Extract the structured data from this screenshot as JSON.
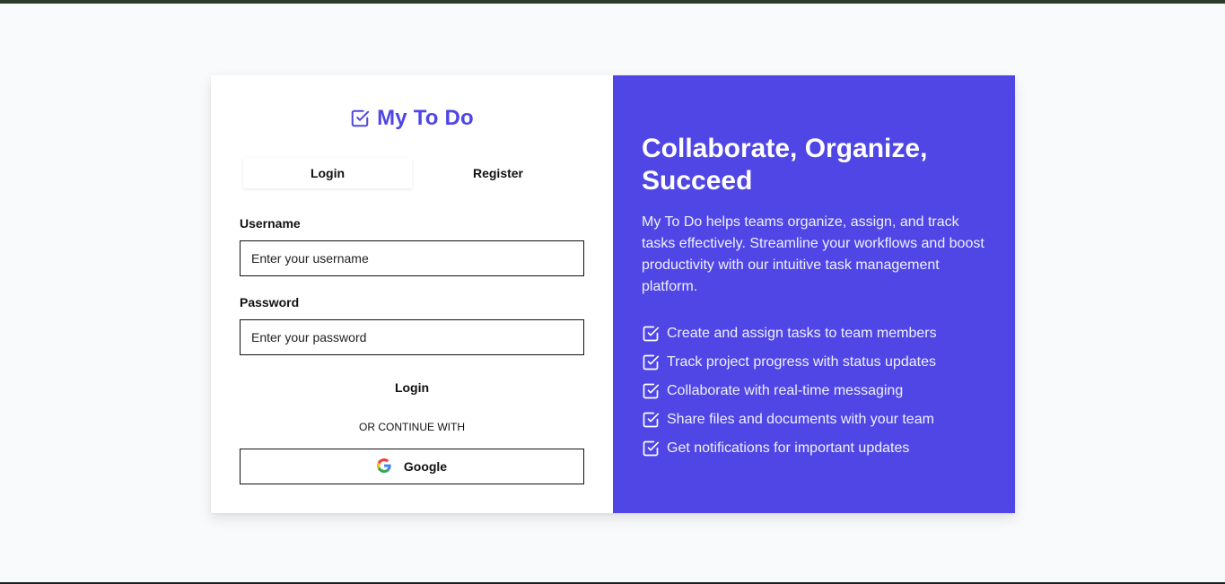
{
  "brand": {
    "title": "My To Do",
    "icon": "check-square-icon",
    "color": "#5046e5"
  },
  "tabs": [
    {
      "label": "Login",
      "active": true
    },
    {
      "label": "Register",
      "active": false
    }
  ],
  "form": {
    "username_label": "Username",
    "username_placeholder": "Enter your username",
    "username_value": "",
    "password_label": "Password",
    "password_placeholder": "Enter your password",
    "password_value": "",
    "submit_label": "Login",
    "divider_text": "OR CONTINUE WITH",
    "google_label": "Google"
  },
  "promo": {
    "headline": "Collaborate, Organize, Succeed",
    "description": "My To Do helps teams organize, assign, and track tasks effectively. Streamline your workflows and boost productivity with our intuitive task management platform.",
    "features": [
      "Create and assign tasks to team members",
      "Track project progress with status updates",
      "Collaborate with real-time messaging",
      "Share files and documents with your team",
      "Get notifications for important updates"
    ],
    "background_color": "#5046e5"
  }
}
